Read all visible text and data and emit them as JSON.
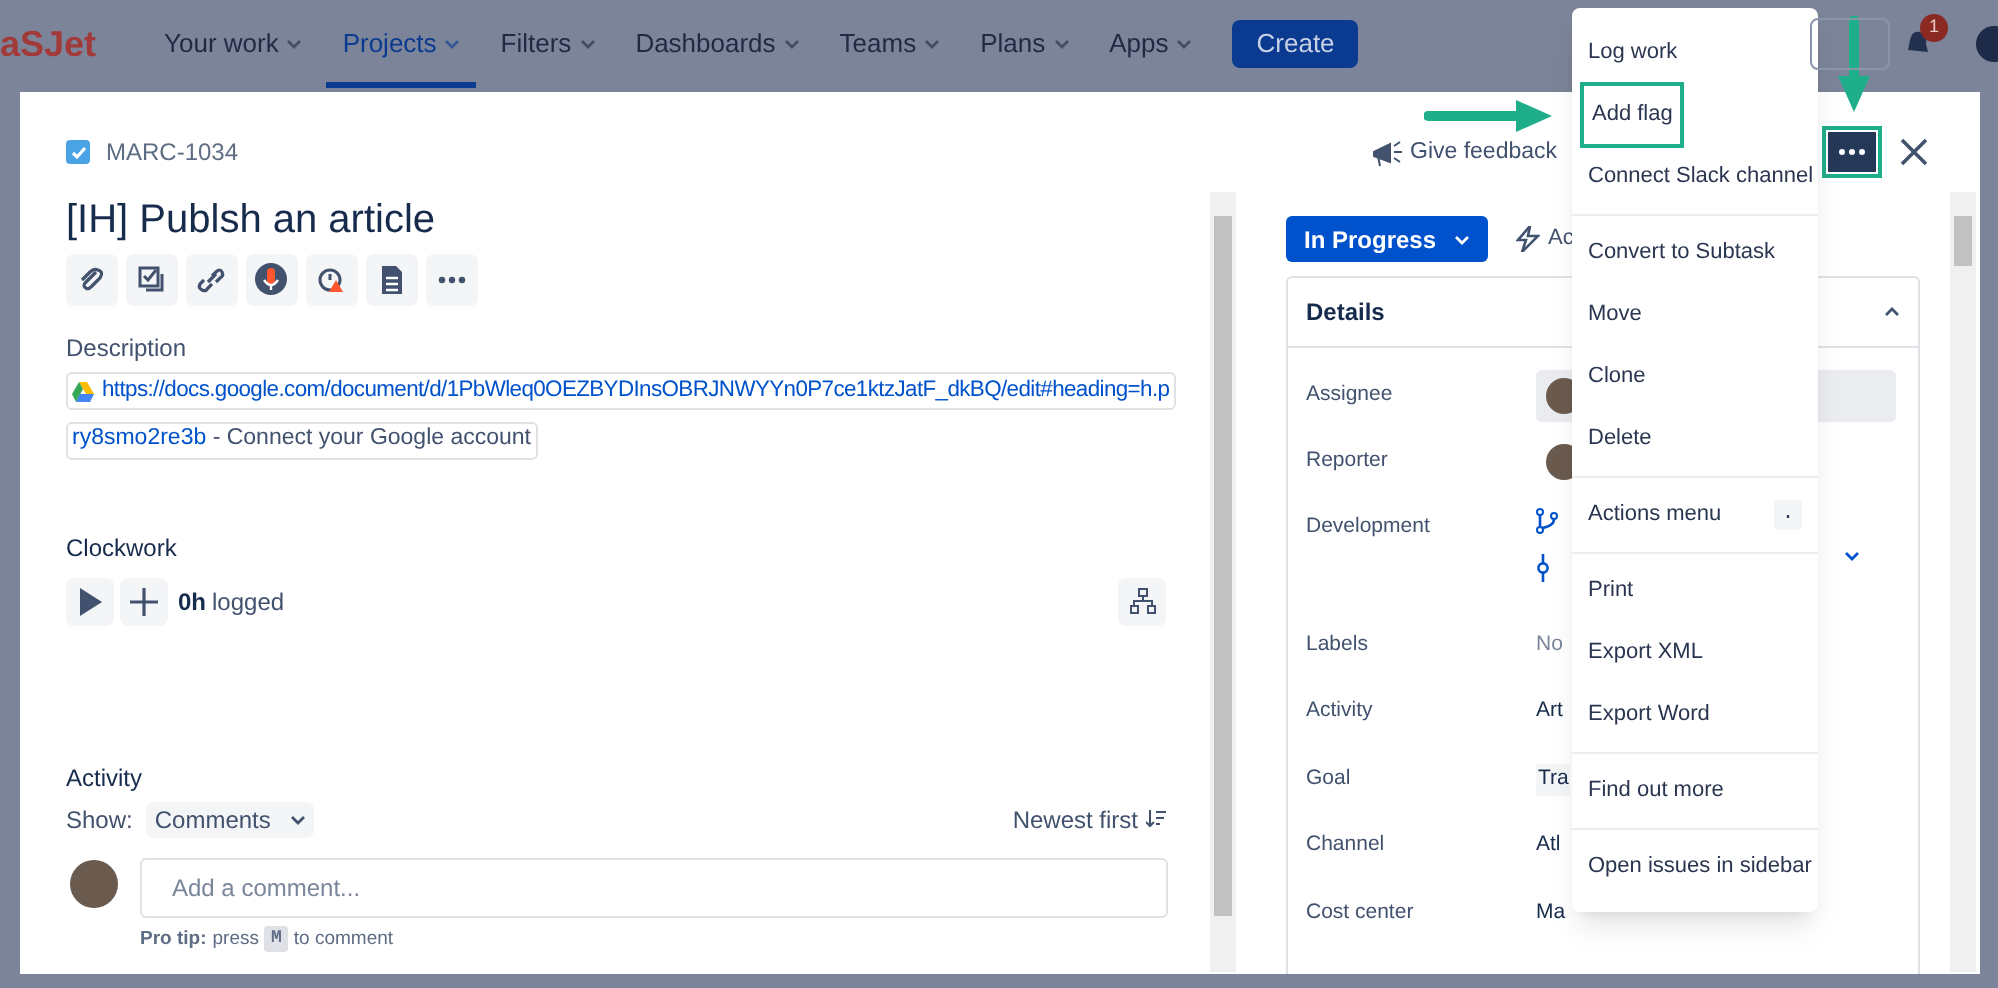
{
  "nav": {
    "logo": "aSJet",
    "items": [
      {
        "label": "Your work",
        "selected": false
      },
      {
        "label": "Projects",
        "selected": true
      },
      {
        "label": "Filters",
        "selected": false
      },
      {
        "label": "Dashboards",
        "selected": false
      },
      {
        "label": "Teams",
        "selected": false
      },
      {
        "label": "Plans",
        "selected": false
      },
      {
        "label": "Apps",
        "selected": false
      }
    ],
    "create": "Create",
    "notifications": "1"
  },
  "issue": {
    "key": "MARC-1034",
    "title": "[IH] Publsh an article",
    "give_feedback": "Give feedback",
    "description": {
      "label": "Description",
      "link_1": "https://docs.google.com/document/d/1PbWleq0OEZBYDInsOBRJNWYYn0P7ce1ktzJatF_dkBQ/edit#heading=h.p",
      "link_2": "ry8smo2re3b",
      "connect": " - Connect your Google account"
    },
    "clockwork": {
      "label": "Clockwork",
      "hours": "0h",
      "logged": "logged"
    },
    "activity": {
      "label": "Activity",
      "show": "Show:",
      "filter": "Comments",
      "sort": "Newest first",
      "comment_placeholder": "Add a comment...",
      "tip_label": "Pro tip:",
      "tip_press": "press",
      "tip_key": "M",
      "tip_end": "to comment"
    }
  },
  "side": {
    "status": "In Progress",
    "action": "Ac",
    "details_title": "Details",
    "fields": [
      {
        "label": "Assignee",
        "kind": "user"
      },
      {
        "label": "Reporter",
        "kind": "user"
      },
      {
        "label": "Development",
        "kind": "dev"
      },
      {
        "label": "Labels",
        "kind": "muted",
        "value": "No"
      },
      {
        "label": "Activity",
        "kind": "text",
        "value": "Art"
      },
      {
        "label": "Goal",
        "kind": "tag",
        "value": "Tra"
      },
      {
        "label": "Channel",
        "kind": "text",
        "value": "Atl"
      },
      {
        "label": "Cost center",
        "kind": "text",
        "value": "Ma"
      }
    ]
  },
  "menu": {
    "sections": [
      [
        {
          "label": "Log work",
          "highlighted": false
        },
        {
          "label": "Add flag",
          "highlighted": true
        },
        {
          "label": "Connect Slack channel",
          "highlighted": false
        }
      ],
      [
        {
          "label": "Convert to Subtask",
          "highlighted": false
        },
        {
          "label": "Move",
          "highlighted": false
        },
        {
          "label": "Clone",
          "highlighted": false
        },
        {
          "label": "Delete",
          "highlighted": false
        }
      ],
      [
        {
          "label": "Actions menu",
          "highlighted": false,
          "shortcut": "."
        }
      ],
      [
        {
          "label": "Print",
          "highlighted": false
        },
        {
          "label": "Export XML",
          "highlighted": false
        },
        {
          "label": "Export Word",
          "highlighted": false
        }
      ],
      [
        {
          "label": "Find out more",
          "highlighted": false
        }
      ],
      [
        {
          "label": "Open issues in sidebar",
          "highlighted": false
        }
      ]
    ]
  }
}
